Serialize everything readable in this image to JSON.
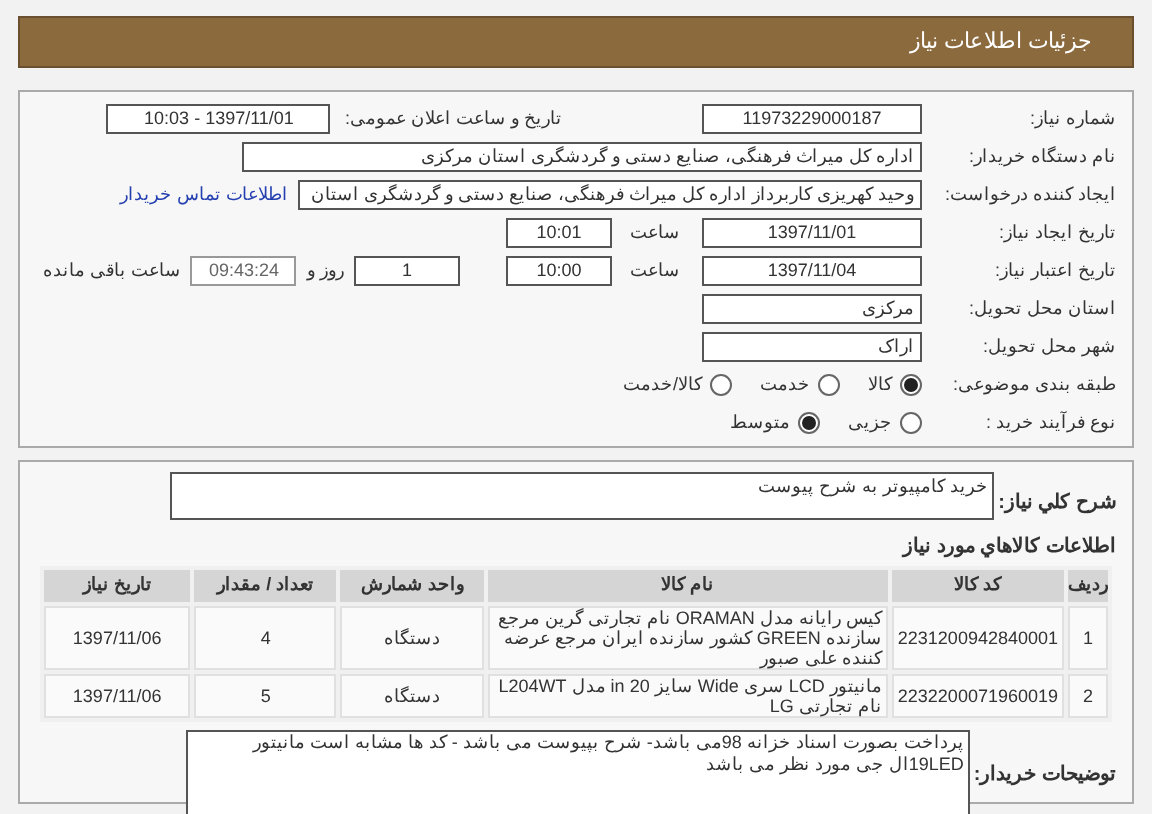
{
  "header": {
    "title": "جزئیات اطلاعات نیاز"
  },
  "need_number": {
    "label": "شماره نیاز:",
    "value": "11973229000187"
  },
  "announce": {
    "label": "تاریخ و ساعت اعلان عمومی:",
    "value": "1397/11/01 - 10:03"
  },
  "buyer_org": {
    "label": "نام دستگاه خریدار:",
    "value": "اداره کل میراث فرهنگی، صنایع دستی و گردشگری استان مرکزی"
  },
  "requester": {
    "label": "ایجاد کننده درخواست:",
    "value": "وحید کهریزی کاربرداز اداره کل میراث فرهنگی، صنایع دستی و گردشگری استان",
    "link": "اطلاعات تماس خریدار"
  },
  "created": {
    "label": "تاریخ ایجاد نیاز:",
    "date": "1397/11/01",
    "time_label": "ساعت",
    "time": "10:01"
  },
  "validity": {
    "label": "تاریخ اعتبار نیاز:",
    "date": "1397/11/04",
    "time_label": "ساعت",
    "time": "10:00",
    "days": "1",
    "days_label": "روز و",
    "remaining": "09:43:24",
    "remaining_label": "ساعت باقی مانده"
  },
  "province": {
    "label": "استان محل تحویل:",
    "value": "مرکزی"
  },
  "city": {
    "label": "شهر محل تحویل:",
    "value": "اراک"
  },
  "category": {
    "label": "طبقه بندی موضوعی:",
    "options": [
      {
        "label": "کالا",
        "selected": true
      },
      {
        "label": "خدمت",
        "selected": false
      },
      {
        "label": "کالا/خدمت",
        "selected": false
      }
    ]
  },
  "process": {
    "label": "نوع فرآیند خرید :",
    "options": [
      {
        "label": "جزیی",
        "selected": false
      },
      {
        "label": "متوسط",
        "selected": true
      }
    ]
  },
  "description": {
    "label": "شرح كلي نياز:",
    "value": "خرید کامپیوتر به شرح پیوست"
  },
  "items_title": "اطلاعات كالاهاي مورد نياز",
  "table": {
    "columns": [
      "ردیف",
      "کد کالا",
      "نام کالا",
      "واحد شمارش",
      "تعداد / مقدار",
      "تاریخ نیاز"
    ],
    "rows": [
      [
        "1",
        "2231200942840001",
        "کیس رایانه مدل ORAMAN نام تجارتی گرین مرجع سازنده GREEN کشور سازنده ایران مرجع عرضه کننده علی صبور",
        "دستگاه",
        "4",
        "1397/11/06"
      ],
      [
        "2",
        "2232200071960019",
        "مانیتور LCD سری Wide سایز 20 in مدل L204WT نام تجارتی LG",
        "دستگاه",
        "5",
        "1397/11/06"
      ]
    ]
  },
  "buyer_notes": {
    "label": "توضیحات خریدار:",
    "value": "پرداخت بصورت اسناد خزانه 98می باشد- شرح بپیوست می باشد - کد ها مشابه است مانیتور 19LEDال جی مورد نظر می باشد"
  }
}
